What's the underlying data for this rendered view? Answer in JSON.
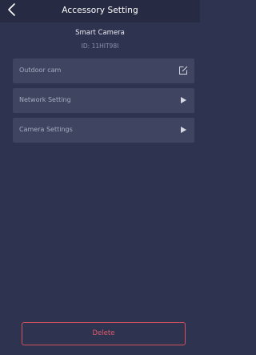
{
  "header": {
    "title": "Accessory Setting",
    "back_icon": "chevron-left-icon"
  },
  "device": {
    "name": "Smart Camera",
    "id_text": "ID: 11HIT98I"
  },
  "settings": [
    {
      "label": "Outdoor cam",
      "icon": "edit-icon"
    },
    {
      "label": "Network Setting",
      "icon": "play-right-icon"
    },
    {
      "label": "Camera Settings",
      "icon": "play-right-icon"
    }
  ],
  "actions": {
    "delete_label": "Delete"
  },
  "colors": {
    "background": "#2e3350",
    "header": "#262a43",
    "row": "#3f4560",
    "delete_accent": "#d2515f"
  }
}
